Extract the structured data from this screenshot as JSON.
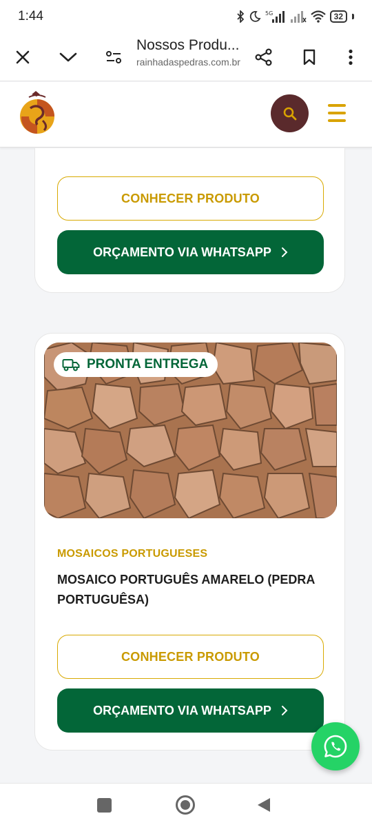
{
  "status": {
    "time": "1:44",
    "network": "5G",
    "battery": "32"
  },
  "browser": {
    "title": "Nossos Produ...",
    "url": "rainhadaspedras.com.br",
    "icons": [
      "close-icon",
      "chevron-down-icon",
      "page-settings-icon",
      "share-icon",
      "bookmark-icon",
      "more-vertical-icon"
    ]
  },
  "header": {
    "logo_name": "rainha-das-pedras-logo",
    "search_icon": "search-icon",
    "menu_icon": "hamburger-icon",
    "colors": {
      "search_bg": "#5a2a2c",
      "menu": "#d9a300"
    }
  },
  "cards": [
    {
      "buttons": {
        "details_label": "CONHECER PRODUTO",
        "whatsapp_label": "ORÇAMENTO VIA WHATSAPP"
      }
    },
    {
      "badge": "PRONTA ENTREGA",
      "badge_icon": "truck-icon",
      "category": "MOSAICOS PORTUGUESES",
      "title": "MOSAICO PORTUGUÊS AMARELO (PEDRA PORTUGUÊSA)",
      "buttons": {
        "details_label": "CONHECER PRODUTO",
        "whatsapp_label": "ORÇAMENTO VIA WHATSAPP"
      }
    }
  ],
  "colors": {
    "accent_gold": "#c99a00",
    "whatsapp_green": "#036638",
    "whatsapp_float": "#25d366"
  }
}
